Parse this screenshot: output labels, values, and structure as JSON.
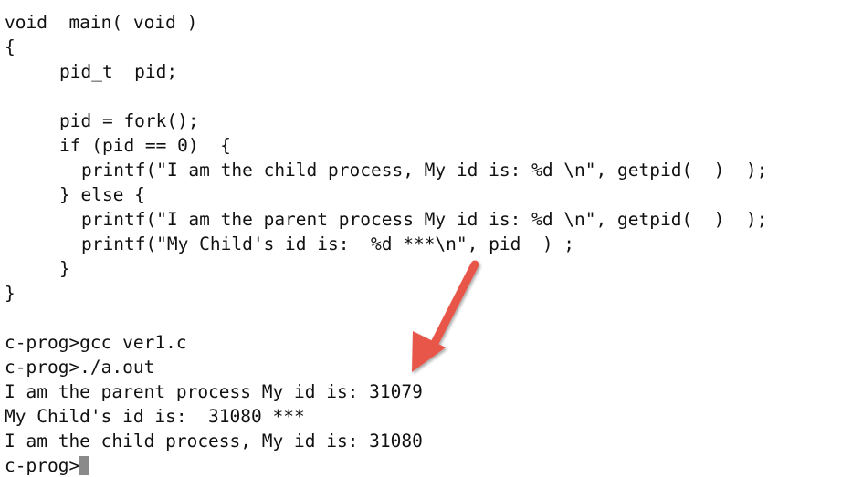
{
  "code": {
    "lines": [
      "void  main( void )",
      "{",
      "pid_t  pid;",
      "pid = fork();",
      "if (pid == 0)  {",
      "printf(\"I am the child process, My id is: %d \\n\", getpid(  )  );",
      "} else {",
      "printf(\"I am the parent process My id is: %d \\n\", getpid(  )  );",
      "printf(\"My Child's id is:  %d ***\\n\", pid  ) ;",
      "}",
      "}"
    ]
  },
  "terminal": {
    "lines": [
      "c-prog>gcc ver1.c",
      "c-prog>./a.out",
      "I am the parent process My id is: 31079",
      "My Child's id is:  31080 ***",
      "I am the child process, My id is: 31080"
    ],
    "prompt": "c-prog>"
  },
  "annotation": {
    "arrow_color": "#e8574a"
  }
}
